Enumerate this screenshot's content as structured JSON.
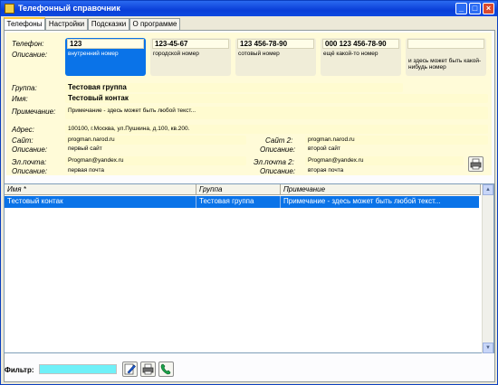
{
  "window": {
    "title": "Телефонный справочник"
  },
  "titlebar_buttons": {
    "minimize": "_",
    "maximize": "□",
    "close": "×"
  },
  "tabs": [
    {
      "label": "Телефоны"
    },
    {
      "label": "Настройки"
    },
    {
      "label": "Подсказки"
    },
    {
      "label": "О программе"
    }
  ],
  "phones": {
    "phone_label": "Телефон:",
    "desc_label": "Описание:",
    "cards": [
      {
        "number": "123",
        "description": "внутренний номер",
        "selected": true
      },
      {
        "number": "123-45-67",
        "description": "городской номер",
        "selected": false
      },
      {
        "number": "123 456-78-90",
        "description": "сотовый номер",
        "selected": false
      },
      {
        "number": "000 123 456-78-90",
        "description": "ещё какой-то номер",
        "selected": false
      },
      {
        "number": "",
        "description": "и здесь может быть какой-нибудь номер",
        "selected": false
      }
    ]
  },
  "contact": {
    "group_label": "Группа:",
    "group": "Тестовая группа",
    "name_label": "Имя:",
    "name": "Тестовый контак",
    "note_label": "Примечание:",
    "note": "Примечание - здесь может быть любой текст...",
    "address_label": "Адрес:",
    "address": "100100, г.Москва, ул.Пушкина, д.100, кв.200.",
    "site_label": "Сайт:",
    "site": "progman.narod.ru",
    "site_desc_label": "Описание:",
    "site_desc": "первый сайт",
    "site2_label": "Сайт 2:",
    "site2": "progman.narod.ru",
    "site2_desc_label": "Описание:",
    "site2_desc": "второй сайт",
    "email_label": "Эл.почта:",
    "email": "Progman@yandex.ru",
    "email_desc_label": "Описание:",
    "email_desc": "первая почта",
    "email2_label": "Эл.почта 2:",
    "email2": "Progman@yandex.ru",
    "email2_desc_label": "Описание:",
    "email2_desc": "вторая почта"
  },
  "grid": {
    "columns": [
      "Имя *",
      "Группа",
      "Примечание"
    ],
    "rows": [
      {
        "name": "Тестовый контак",
        "group": "Тестовая группа",
        "note": "Примечание - здесь может быть любой текст...",
        "selected": true
      }
    ]
  },
  "filter": {
    "label": "Фильтр:",
    "value": ""
  },
  "colors": {
    "selection": "#0a73e8",
    "cream": "#fffbd8",
    "filter_bg": "#6ff0f8",
    "titlebar": "#0a3fd8"
  },
  "icons": [
    "print-icon",
    "edit-icon",
    "phone-icon"
  ]
}
